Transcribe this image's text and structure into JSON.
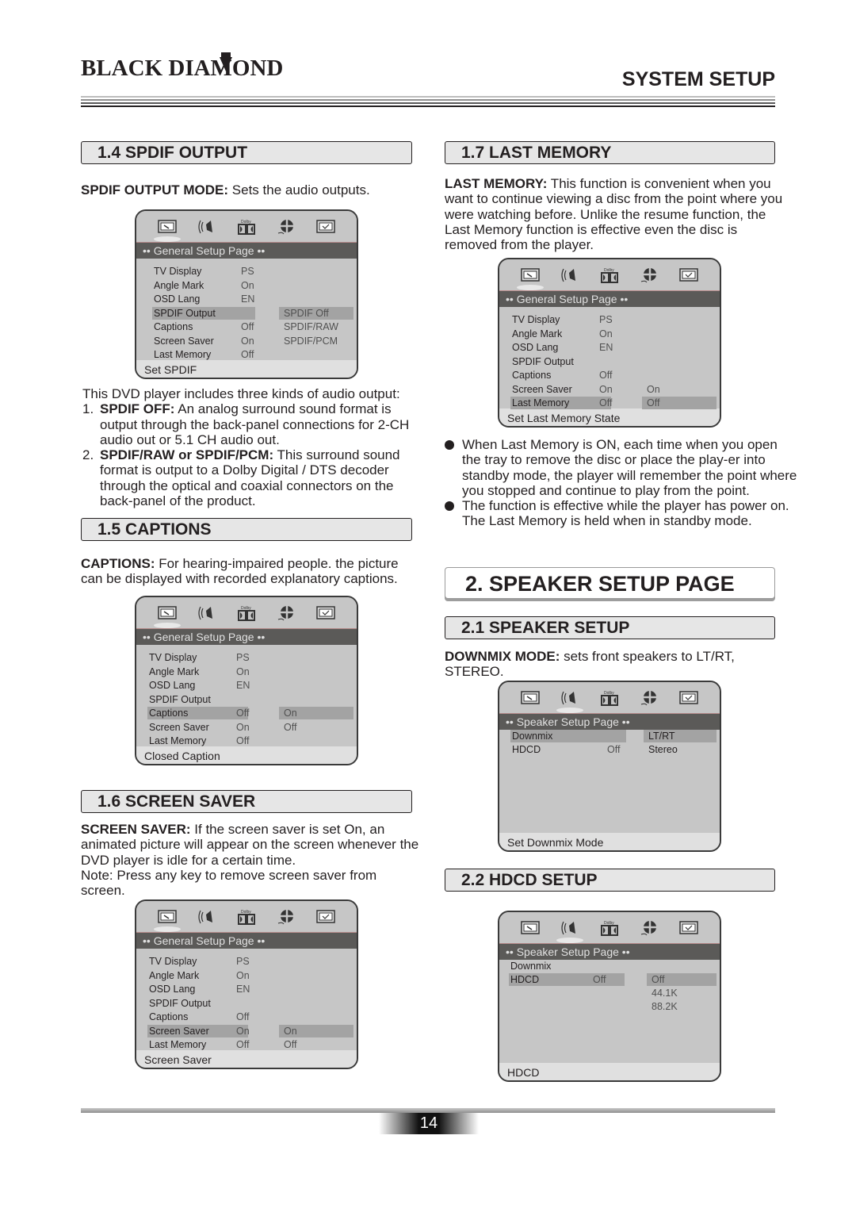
{
  "header": {
    "brand": "BLACK DIAMOND",
    "section_title": "SYSTEM SETUP"
  },
  "sections": {
    "spdif": {
      "heading": "1.4 SPDIF OUTPUT",
      "intro_bold": "SPDIF OUTPUT MODE:",
      "intro_text": " Sets the audio outputs.",
      "desc_lead": "This DVD player includes three kinds of audio output:",
      "items": [
        {
          "num": "1.",
          "bold": "SPDIF OFF:",
          "text": "  An analog surround sound format is output through the back-panel connections for 2-CH audio out or 5.1 CH audio out."
        },
        {
          "num": "2.",
          "bold": "SPDIF/RAW or SPDIF/PCM:",
          "text": " This surround sound format is output to a Dolby Digital / DTS decoder through the optical and coaxial connectors on the back-panel of the product."
        }
      ]
    },
    "captions": {
      "heading": "1.5 CAPTIONS",
      "bold": "CAPTIONS:",
      "text": " For hearing-impaired people. the picture can be displayed with recorded explanatory captions."
    },
    "screen_saver": {
      "heading": "1.6 SCREEN SAVER",
      "bold": "SCREEN SAVER:",
      "text": " If the screen saver is set On, an animated picture will appear on the screen whenever the DVD player is idle for a certain time.",
      "note": "Note: Press any key to remove screen saver from screen."
    },
    "last_memory": {
      "heading": "1.7 LAST MEMORY",
      "bold": "LAST MEMORY:",
      "text": "  This function is convenient when you want to continue viewing a disc from the point where you were watching before. Unlike the resume function, the Last Memory function is effective even the disc is removed from the player.",
      "bullets": [
        "When Last Memory is ON, each time when you open the tray to remove the disc or place the play-er into standby mode, the player will remember the point where you stopped and continue to play from the point.",
        "The function is effective while the player has power on. The Last Memory is held when in standby mode."
      ]
    },
    "speaker_page": {
      "heading": "2. SPEAKER SETUP PAGE"
    },
    "speaker_setup": {
      "heading": "2.1 SPEAKER SETUP",
      "bold": "DOWNMIX MODE:",
      "text": "  sets front speakers to LT/RT, STEREO."
    },
    "hdcd_setup": {
      "heading": "2.2 HDCD SETUP"
    }
  },
  "osd_icons": [
    "general-setup-icon",
    "speaker-setup-icon",
    "dolby-icon",
    "video-setup-icon",
    "preference-icon"
  ],
  "osd_screens": {
    "spdif": {
      "title": "•• General Setup Page ••",
      "rows": [
        {
          "label": "TV Display",
          "value": "PS"
        },
        {
          "label": "Angle Mark",
          "value": "On"
        },
        {
          "label": "OSD Lang",
          "value": "EN"
        },
        {
          "label": "SPDIF Output",
          "value": ""
        },
        {
          "label": "Captions",
          "value": "Off"
        },
        {
          "label": "Screen Saver",
          "value": "On"
        },
        {
          "label": "Last Memory",
          "value": "Off"
        }
      ],
      "options": [
        "SPDIF Off",
        "SPDIF/RAW",
        "SPDIF/PCM"
      ],
      "status": "Set SPDIF"
    },
    "captions": {
      "title": "•• General Setup Page ••",
      "rows": [
        {
          "label": "TV Display",
          "value": "PS"
        },
        {
          "label": "Angle Mark",
          "value": "On"
        },
        {
          "label": "OSD Lang",
          "value": "EN"
        },
        {
          "label": "SPDIF Output",
          "value": ""
        },
        {
          "label": "Captions",
          "value": "Off"
        },
        {
          "label": "Screen Saver",
          "value": "On"
        },
        {
          "label": "Last Memory",
          "value": "Off"
        }
      ],
      "options": [
        "On",
        "Off"
      ],
      "status": "Closed Caption"
    },
    "screen_saver": {
      "title": "•• General Setup Page ••",
      "rows": [
        {
          "label": "TV Display",
          "value": "PS"
        },
        {
          "label": "Angle Mark",
          "value": "On"
        },
        {
          "label": "OSD Lang",
          "value": "EN"
        },
        {
          "label": "SPDIF Output",
          "value": ""
        },
        {
          "label": "Captions",
          "value": "Off"
        },
        {
          "label": "Screen Saver",
          "value": "On"
        },
        {
          "label": "Last Memory",
          "value": "Off"
        }
      ],
      "options": [
        "On",
        "Off"
      ],
      "status": "Screen Saver"
    },
    "last_memory": {
      "title": "•• General Setup Page ••",
      "rows": [
        {
          "label": "TV Display",
          "value": "PS"
        },
        {
          "label": "Angle Mark",
          "value": "On"
        },
        {
          "label": "OSD Lang",
          "value": "EN"
        },
        {
          "label": "SPDIF Output",
          "value": ""
        },
        {
          "label": "Captions",
          "value": "Off"
        },
        {
          "label": "Screen Saver",
          "value": "On"
        },
        {
          "label": "Last Memory",
          "value": "Off"
        }
      ],
      "options": [
        "On",
        "Off"
      ],
      "status": "Set Last Memory State"
    },
    "downmix": {
      "title": "•• Speaker Setup Page ••",
      "rows": [
        {
          "label": "Downmix",
          "value": ""
        },
        {
          "label": "HDCD",
          "value": "Off"
        }
      ],
      "options": [
        "LT/RT",
        "Stereo"
      ],
      "status": "Set Downmix Mode"
    },
    "hdcd": {
      "title": "•• Speaker Setup Page ••",
      "rows": [
        {
          "label": "Downmix",
          "value": ""
        },
        {
          "label": "HDCD",
          "value": "Off"
        }
      ],
      "options": [
        "Off",
        "44.1K",
        "88.2K"
      ],
      "status": "HDCD"
    }
  },
  "footer": {
    "page_number": "14"
  }
}
